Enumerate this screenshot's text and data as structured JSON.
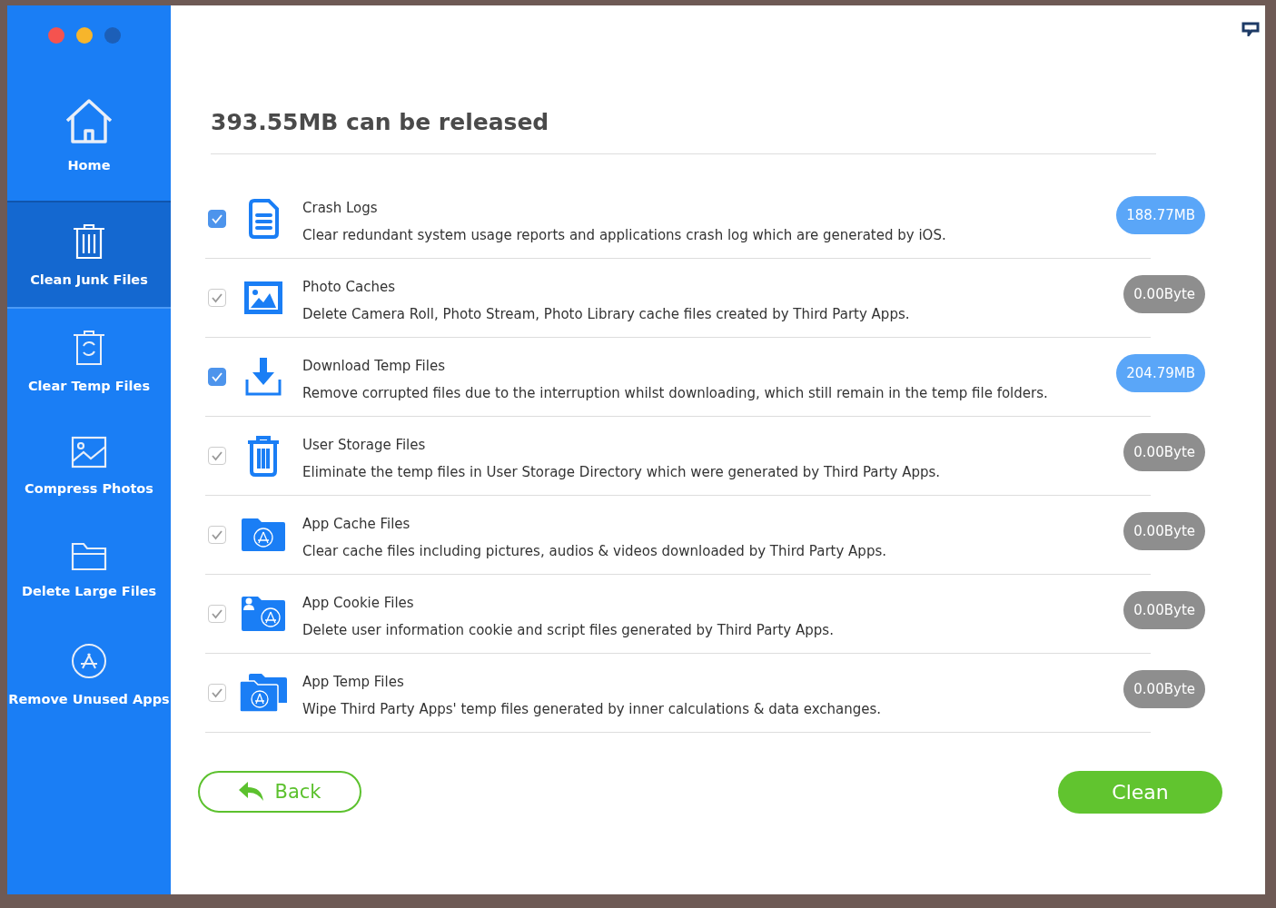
{
  "sidebar": {
    "items": [
      {
        "kind": "home",
        "label": "Home",
        "selected": false
      },
      {
        "kind": "trash",
        "label": "Clean Junk Files",
        "selected": true
      },
      {
        "kind": "recycle",
        "label": "Clear Temp Files",
        "selected": false
      },
      {
        "kind": "photo",
        "label": "Compress Photos",
        "selected": false
      },
      {
        "kind": "folder",
        "label": "Delete Large Files",
        "selected": false
      },
      {
        "kind": "apps",
        "label": "Remove Unused Apps",
        "selected": false
      }
    ]
  },
  "heading": "393.55MB can be released",
  "items": [
    {
      "kind": "document",
      "title": "Crash Logs",
      "description": "Clear redundant system usage reports and applications crash log which are generated by iOS.",
      "size": "188.77MB",
      "checked": true,
      "disabled": false
    },
    {
      "kind": "photo",
      "title": "Photo Caches",
      "description": "Delete Camera Roll, Photo Stream, Photo Library cache files created by Third Party Apps.",
      "size": "0.00Byte",
      "checked": true,
      "disabled": true
    },
    {
      "kind": "download",
      "title": "Download Temp Files",
      "description": "Remove corrupted files due to the interruption whilst downloading, which still remain in the temp file folders.",
      "size": "204.79MB",
      "checked": true,
      "disabled": false
    },
    {
      "kind": "trash",
      "title": "User Storage Files",
      "description": "Eliminate the temp files in User Storage Directory which were generated by Third Party Apps.",
      "size": "0.00Byte",
      "checked": true,
      "disabled": true
    },
    {
      "kind": "app-folder",
      "title": "App Cache Files",
      "description": "Clear cache files including pictures, audios & videos downloaded by Third Party Apps.",
      "size": "0.00Byte",
      "checked": true,
      "disabled": true
    },
    {
      "kind": "cookie-folder",
      "title": "App Cookie Files",
      "description": "Delete user information cookie and script files generated by Third Party Apps.",
      "size": "0.00Byte",
      "checked": true,
      "disabled": true
    },
    {
      "kind": "temp-folder",
      "title": "App Temp Files",
      "description": "Wipe Third Party Apps' temp files generated by inner calculations & data exchanges.",
      "size": "0.00Byte",
      "checked": true,
      "disabled": true
    }
  ],
  "buttons": {
    "back": "Back",
    "clean": "Clean"
  }
}
